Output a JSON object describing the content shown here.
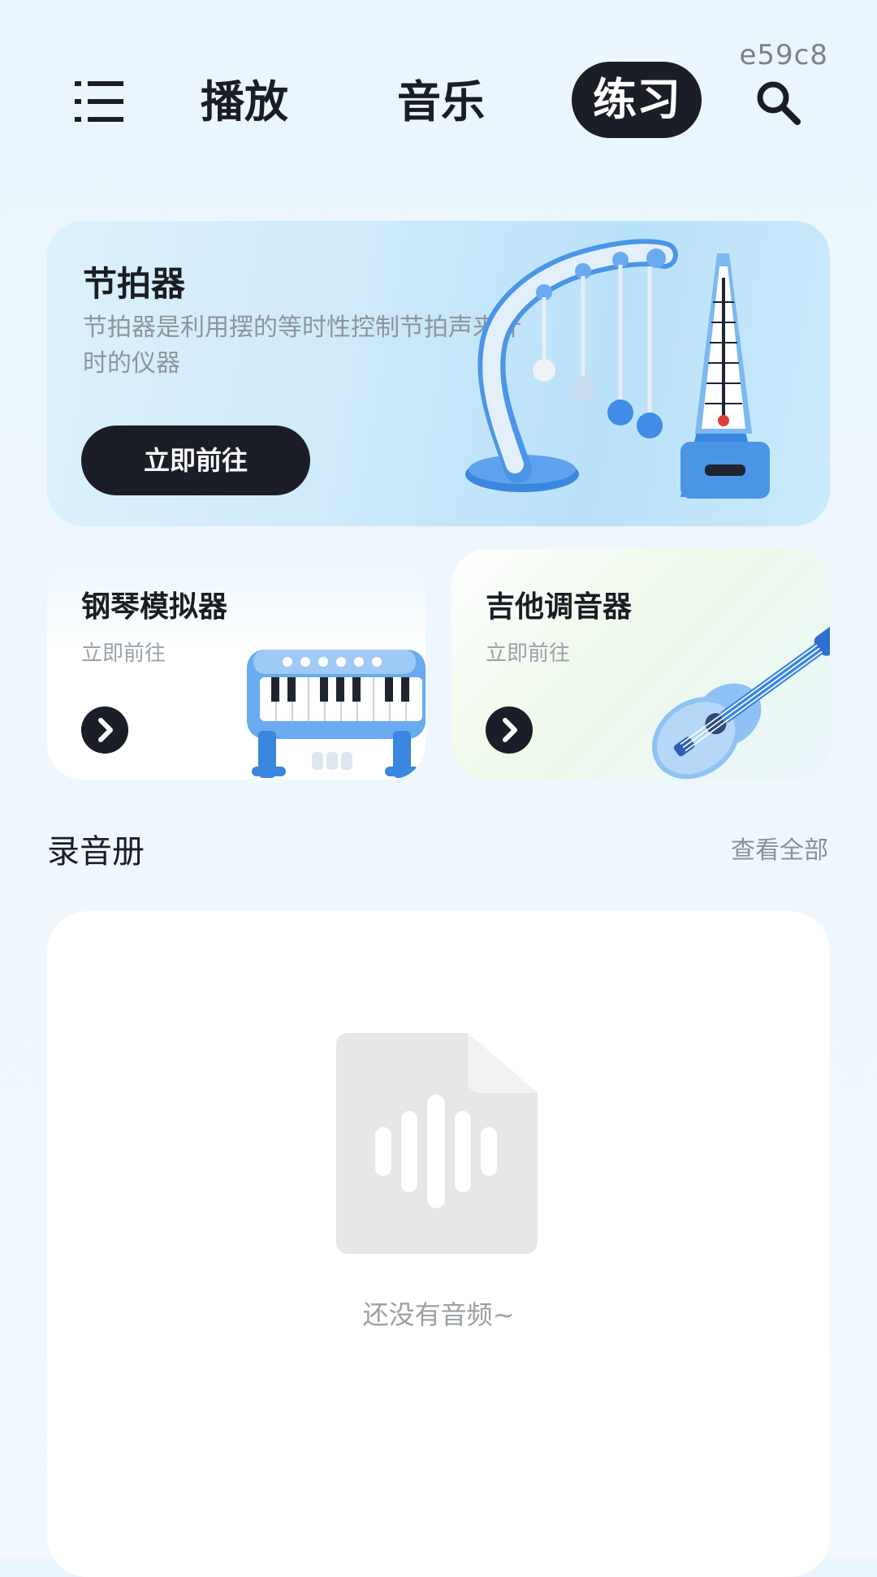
{
  "corner_tag": "e59c8",
  "header": {
    "tabs": [
      {
        "label": "播放",
        "active": false
      },
      {
        "label": "音乐",
        "active": false
      },
      {
        "label": "练习",
        "active": true
      }
    ],
    "menu_icon": "menu-icon",
    "search_icon": "search-icon"
  },
  "metronome_card": {
    "title": "节拍器",
    "description": "节拍器是利用摆的等时性控制节拍声来计时的仪器",
    "button_label": "立即前往",
    "illustration": "metronome-illustration"
  },
  "tool_cards": [
    {
      "title": "钢琴模拟器",
      "subtitle": "立即前往",
      "icon": "chevron-right-icon",
      "illustration": "piano-illustration"
    },
    {
      "title": "吉他调音器",
      "subtitle": "立即前往",
      "icon": "chevron-right-icon",
      "illustration": "guitar-illustration"
    }
  ],
  "recordings": {
    "title": "录音册",
    "view_all": "查看全部",
    "empty_text": "还没有音频~",
    "empty_icon": "audio-file-icon"
  },
  "colors": {
    "accent_dark": "#1b1e26",
    "illustration_blue": "#3f8de6"
  }
}
